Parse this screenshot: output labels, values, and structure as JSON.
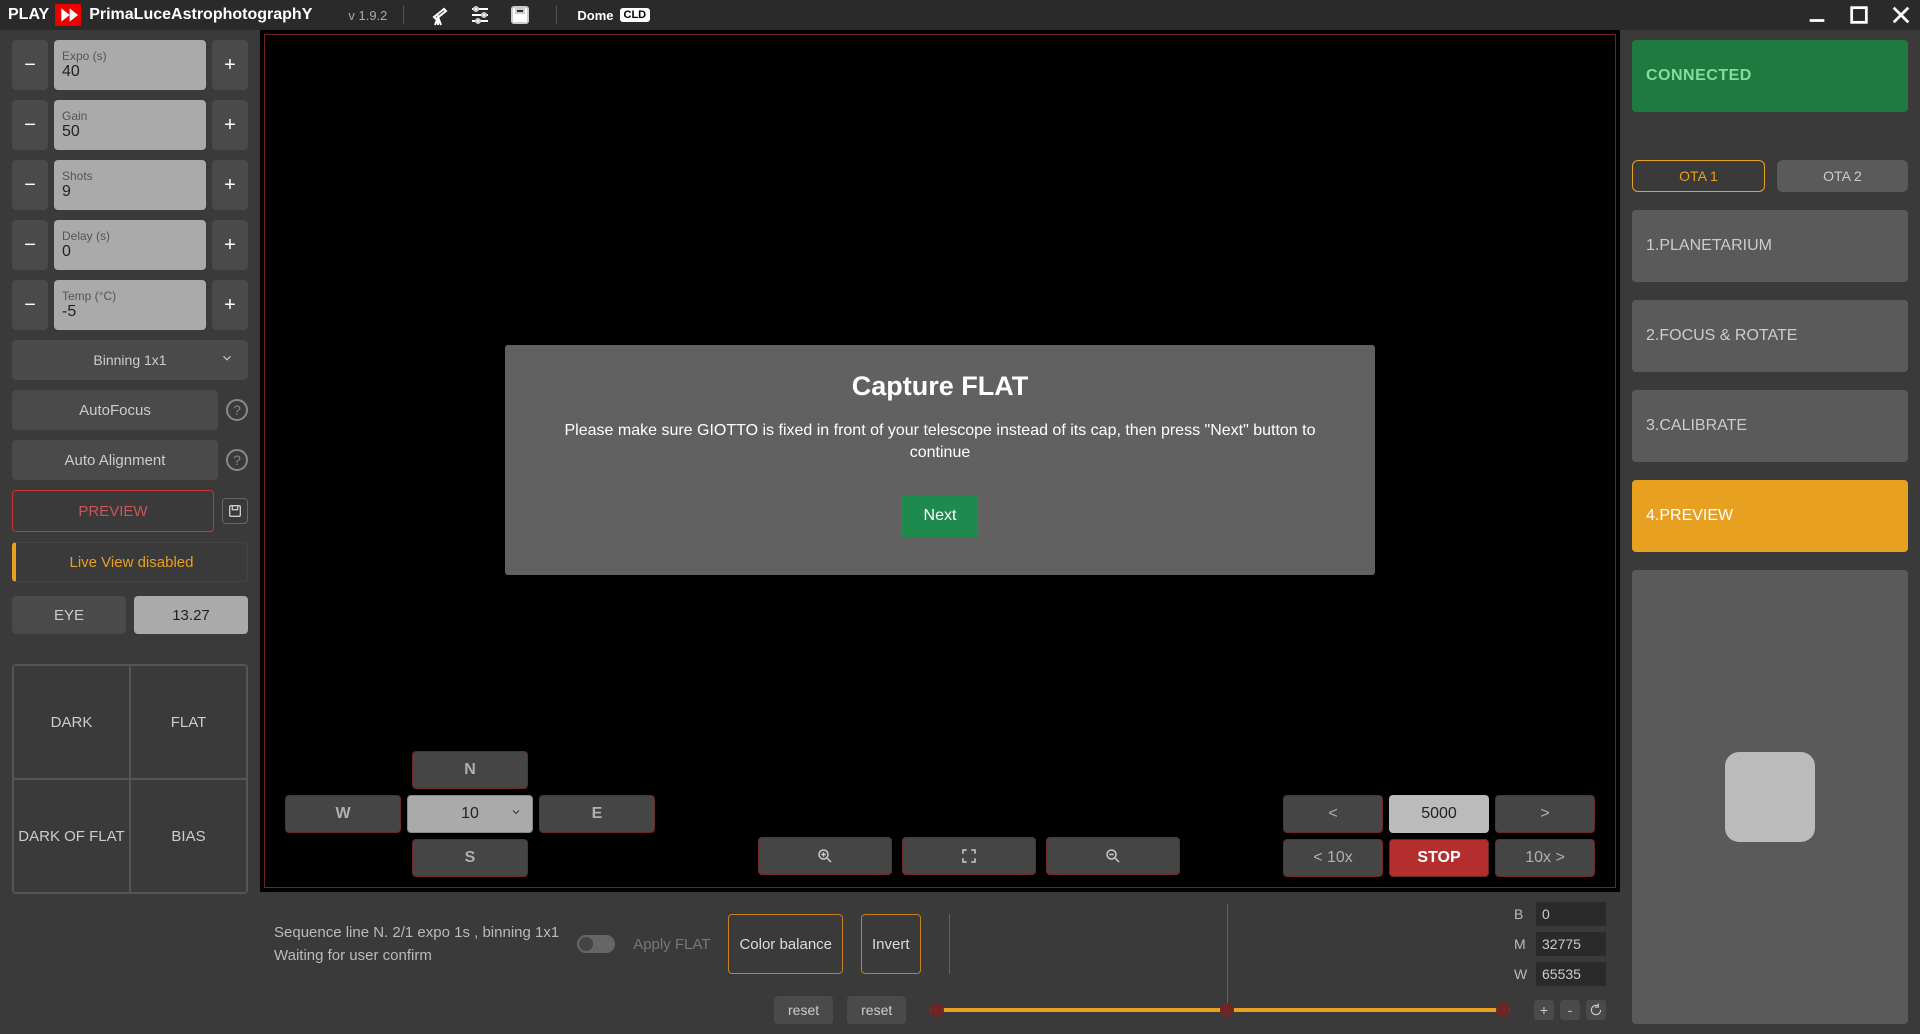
{
  "header": {
    "play": "PLAY",
    "brand_pre": "P",
    "brand_mid": "rima",
    "brand_l": "L",
    "brand_mid2": "uce",
    "brand_a": "A",
    "brand_mid3": "strophotograph",
    "brand_y": "Y",
    "version": "v 1.9.2",
    "dome": "Dome",
    "cld": "CLD"
  },
  "sidebar": {
    "expo_label": "Expo (s)",
    "expo_value": "40",
    "gain_label": "Gain",
    "gain_value": "50",
    "shots_label": "Shots",
    "shots_value": "9",
    "delay_label": "Delay (s)",
    "delay_value": "0",
    "temp_label": "Temp (°C)",
    "temp_value": "-5",
    "binning": "Binning 1x1",
    "autofocus": "AutoFocus",
    "autoalign": "Auto Alignment",
    "preview": "PREVIEW",
    "liveview": "Live View disabled",
    "eye": "EYE",
    "eye_val": "13.27",
    "dark": "DARK",
    "flat": "FLAT",
    "dark_of_flat": "DARK OF FLAT",
    "bias": "BIAS"
  },
  "modal": {
    "title": "Capture FLAT",
    "body": "Please make sure GIOTTO is fixed in front of your telescope instead of its cap, then press \"Next\" button to continue",
    "next": "Next"
  },
  "dirpad": {
    "n": "N",
    "s": "S",
    "e": "E",
    "w": "W",
    "speed": "10"
  },
  "steps": {
    "lt": "<",
    "gt": ">",
    "val": "5000",
    "lt10": "< 10x",
    "stop": "STOP",
    "gt10": "10x >"
  },
  "bottom": {
    "status1": "Sequence line N. 2/1 expo 1s , binning 1x1",
    "status2": "Waiting for user confirm",
    "apply_flat": "Apply FLAT",
    "color_balance": "Color balance",
    "invert": "Invert",
    "reset": "reset",
    "b_label": "B",
    "b_val": "0",
    "m_label": "M",
    "m_val": "32775",
    "w_label": "W",
    "w_val": "65535"
  },
  "right": {
    "connected": "CONNECTED",
    "ota1": "OTA 1",
    "ota2": "OTA 2",
    "m1": "1.PLANETARIUM",
    "m2": "2.FOCUS & ROTATE",
    "m3": "3.CALIBRATE",
    "m4": "4.PREVIEW"
  }
}
